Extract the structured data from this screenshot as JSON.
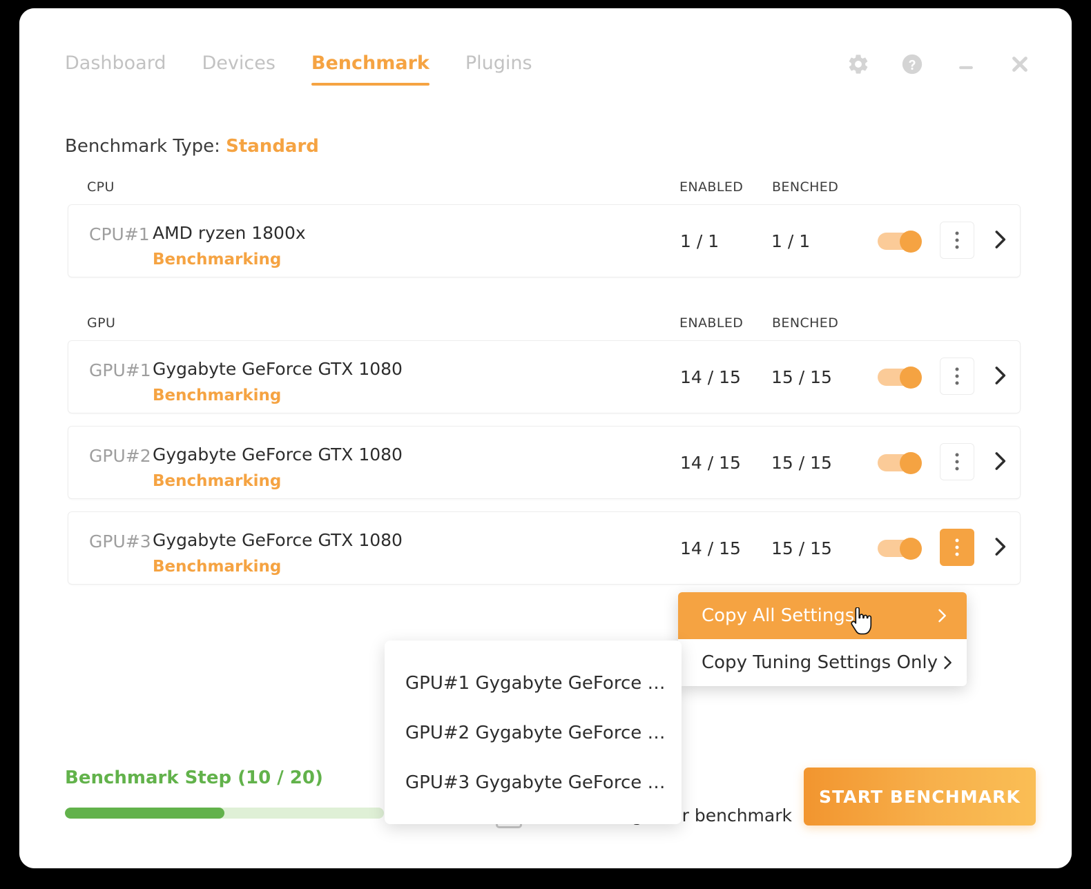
{
  "window": {
    "titlebar": {
      "tabs": [
        {
          "label": "Dashboard",
          "active": false
        },
        {
          "label": "Devices",
          "active": false
        },
        {
          "label": "Benchmark",
          "active": true
        },
        {
          "label": "Plugins",
          "active": false
        }
      ],
      "buttons": [
        {
          "name": "settings-gear-icon",
          "glyph": "gear"
        },
        {
          "name": "help-icon",
          "glyph": "question-circle"
        },
        {
          "name": "minimize-icon",
          "glyph": "minimize"
        },
        {
          "name": "close-icon",
          "glyph": "close"
        }
      ]
    }
  },
  "benchmark_type": {
    "label": "Benchmark Type:",
    "value": "Standard"
  },
  "columns": {
    "cpu_kind": "CPU",
    "gpu_kind": "GPU",
    "enabled": "ENABLED",
    "benched": "BENCHED"
  },
  "cpu_devices": [
    {
      "id": "CPU#1",
      "name": "AMD ryzen 1800x",
      "status": "Benchmarking",
      "enabled": "1 / 1",
      "benched": "1 / 1",
      "toggle_on": true,
      "menu_open": false
    }
  ],
  "gpu_devices": [
    {
      "id": "GPU#1",
      "name": "Gygabyte GeForce GTX 1080",
      "status": "Benchmarking",
      "enabled": "14 / 15",
      "benched": "15 / 15",
      "toggle_on": true,
      "menu_open": false
    },
    {
      "id": "GPU#2",
      "name": "Gygabyte GeForce GTX 1080",
      "status": "Benchmarking",
      "enabled": "14 / 15",
      "benched": "15 / 15",
      "toggle_on": true,
      "menu_open": false
    },
    {
      "id": "GPU#3",
      "name": "Gygabyte GeForce GTX 1080",
      "status": "Benchmarking",
      "enabled": "14 / 15",
      "benched": "15 / 15",
      "toggle_on": true,
      "menu_open": true
    }
  ],
  "context_menu": {
    "items": [
      {
        "label": "Copy All Settings",
        "highlighted": true,
        "has_submenu": true
      },
      {
        "label": "Copy Tuning Settings Only",
        "highlighted": false,
        "has_submenu": true
      }
    ]
  },
  "submenu": {
    "items": [
      {
        "label": "GPU#1 Gygabyte GeForce …"
      },
      {
        "label": "GPU#2 Gygabyte GeForce …"
      },
      {
        "label": "GPU#3 Gygabyte GeForce …"
      }
    ]
  },
  "footer": {
    "step_label": "Benchmark Step (10 / 20)",
    "progress_percent": 50,
    "mining_checkbox_label": "Start mining after benchmark",
    "mining_checked": false,
    "start_button": "START BENCHMARK"
  },
  "colors": {
    "accent_orange": "#f5a342",
    "accent_orange_light": "#fbcb98",
    "progress_green": "#62b24b",
    "progress_track": "#dff0d6",
    "text_dark": "#2d2d2d",
    "text_muted": "#9e9e9e",
    "tab_inactive": "#c2c2c2"
  }
}
